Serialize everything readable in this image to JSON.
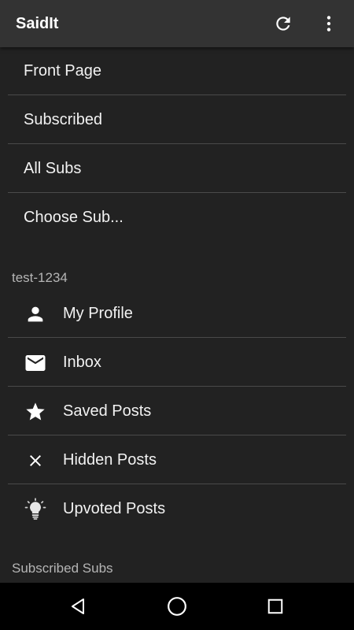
{
  "app_bar": {
    "title": "SaidIt",
    "actions": [
      {
        "icon": "refresh-icon"
      },
      {
        "icon": "more-vert-icon"
      }
    ]
  },
  "main_nav": [
    {
      "label": "Front Page"
    },
    {
      "label": "Subscribed"
    },
    {
      "label": "All Subs"
    },
    {
      "label": "Choose Sub..."
    }
  ],
  "account": {
    "username": "test-1234",
    "items": [
      {
        "label": "My Profile",
        "icon": "person-icon"
      },
      {
        "label": "Inbox",
        "icon": "mail-icon"
      },
      {
        "label": "Saved Posts",
        "icon": "star-icon"
      },
      {
        "label": "Hidden Posts",
        "icon": "close-icon"
      },
      {
        "label": "Upvoted Posts",
        "icon": "lightbulb-icon"
      }
    ]
  },
  "subscribed_section": {
    "header": "Subscribed Subs"
  },
  "system_nav": {
    "buttons": [
      {
        "icon": "back-triangle-icon"
      },
      {
        "icon": "home-circle-icon"
      },
      {
        "icon": "recents-square-icon"
      }
    ]
  },
  "colors": {
    "app_bar_bg": "#333333",
    "background": "#222222",
    "divider": "#4a4a4a",
    "text": "#f2f2f2",
    "section_text": "#b5b5b5",
    "system_bar_bg": "#000000"
  }
}
